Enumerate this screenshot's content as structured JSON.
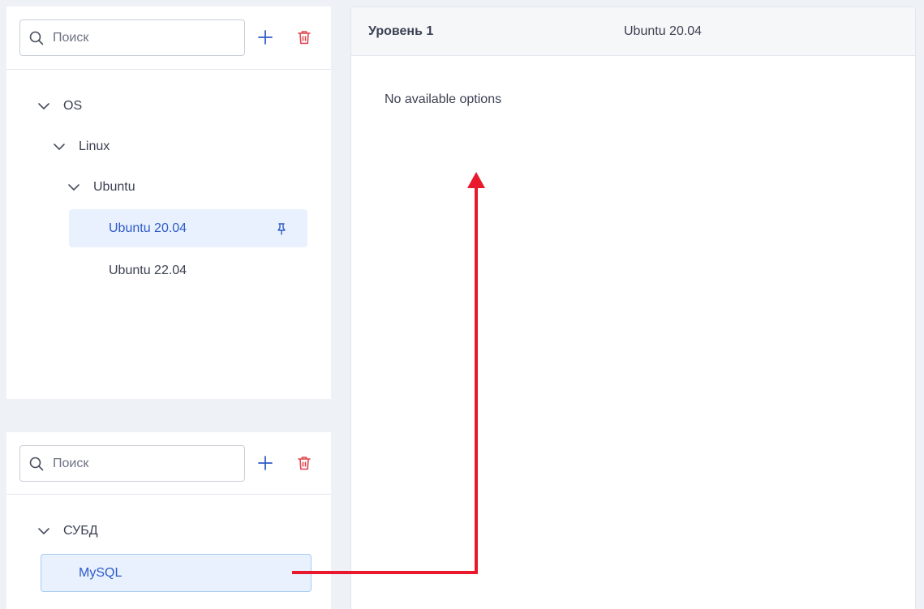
{
  "top_panel": {
    "search": {
      "placeholder": "Поиск",
      "value": ""
    },
    "add_button_icon": "plus-icon",
    "delete_button_icon": "trash-icon",
    "tree": {
      "os_label": "OS",
      "linux_label": "Linux",
      "ubuntu_label": "Ubuntu",
      "ubuntu_2004_label": "Ubuntu 20.04",
      "ubuntu_2204_label": "Ubuntu 22.04",
      "selected_pin_icon": "pin-icon"
    }
  },
  "bottom_panel": {
    "search": {
      "placeholder": "Поиск",
      "value": ""
    },
    "add_button_icon": "plus-icon",
    "delete_button_icon": "trash-icon",
    "tree": {
      "dbms_label": "СУБД",
      "mysql_label": "MySQL"
    }
  },
  "right_panel": {
    "level_label": "Уровень 1",
    "level_value": "Ubuntu 20.04",
    "empty_message": "No available options"
  },
  "colors": {
    "accent": "#2f5bc9",
    "selected_bg": "#e8f1fd",
    "delete": "#e0414b",
    "annotation_arrow": "#e8192c"
  }
}
